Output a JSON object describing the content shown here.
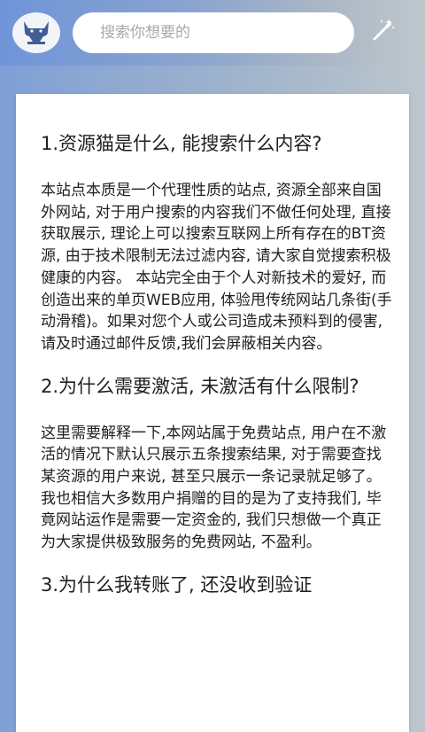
{
  "header": {
    "search_placeholder": "搜索你想要的",
    "logo_icon": "cat-logo-icon",
    "wand_icon": "magic-wand-icon"
  },
  "faq": [
    {
      "question": "1.资源猫是什么, 能搜索什么内容?",
      "answer": "本站点本质是一个代理性质的站点, 资源全部来自国外网站, 对于用户搜索的内容我们不做任何处理, 直接获取展示, 理论上可以搜索互联网上所有存在的BT资源, 由于技术限制无法过滤内容, 请大家自觉搜索积极健康的内容。 本站完全由于个人对新技术的爱好, 而创造出来的单页WEB应用, 体验甩传统网站几条街(手动滑稽)。如果对您个人或公司造成未预料到的侵害, 请及时通过邮件反馈,我们会屏蔽相关内容。"
    },
    {
      "question": "2.为什么需要激活, 未激活有什么限制?",
      "answer": "这里需要解释一下,本网站属于免费站点, 用户在不激活的情况下默认只展示五条搜索结果, 对于需要查找某资源的用户来说, 甚至只展示一条记录就足够了。 我也相信大多数用户捐赠的目的是为了支持我们, 毕竟网站运作是需要一定资金的, 我们只想做一个真正为大家提供极致服务的免费网站, 不盈利。"
    },
    {
      "question": "3.为什么我转账了, 还没收到验证",
      "answer": ""
    }
  ]
}
